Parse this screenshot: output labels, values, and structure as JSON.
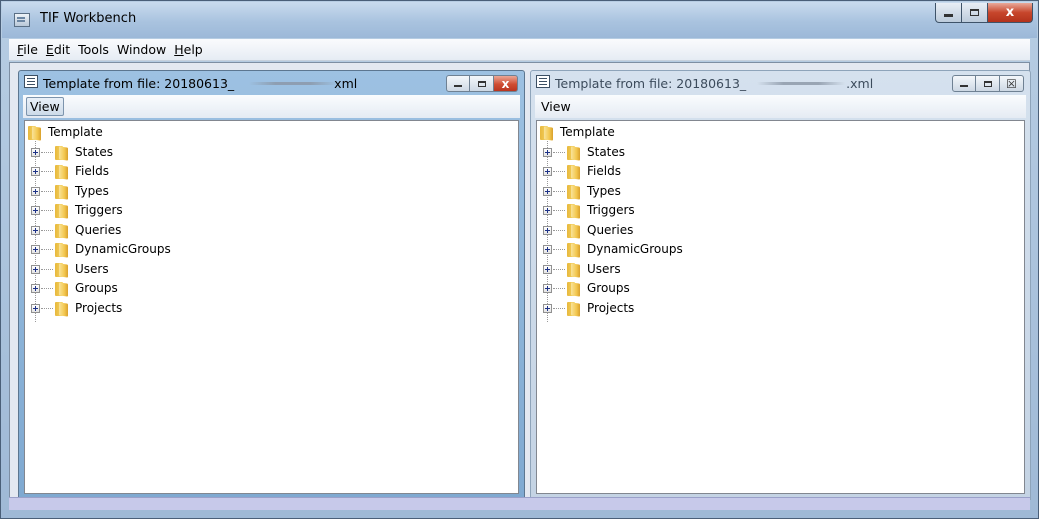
{
  "app": {
    "title": "TIF Workbench",
    "window_controls": {
      "close": "x"
    }
  },
  "menu": {
    "items": [
      {
        "mnemonic": "F",
        "rest": "ile"
      },
      {
        "mnemonic": "E",
        "rest": "dit"
      },
      {
        "mnemonic": "",
        "rest": "Tools"
      },
      {
        "mnemonic": "",
        "rest": "Window"
      },
      {
        "mnemonic": "H",
        "rest": "elp"
      }
    ]
  },
  "left_window": {
    "title_prefix": "Template from file: 20180613_",
    "title_suffix": "xml",
    "view_label": "View",
    "root": "Template",
    "nodes": [
      "States",
      "Fields",
      "Types",
      "Triggers",
      "Queries",
      "DynamicGroups",
      "Users",
      "Groups",
      "Projects"
    ]
  },
  "right_window": {
    "title_prefix": "Template from file: 20180613_",
    "title_suffix": ".xml",
    "view_label": "View",
    "close_glyph": "☒",
    "root": "Template",
    "nodes": [
      "States",
      "Fields",
      "Types",
      "Triggers",
      "Queries",
      "DynamicGroups",
      "Users",
      "Groups",
      "Projects"
    ]
  },
  "colors": {
    "active_title": "#8fb6dc",
    "inactive_title": "#cfdbea",
    "close_red": "#c7462c",
    "folder": "#f3c850"
  }
}
